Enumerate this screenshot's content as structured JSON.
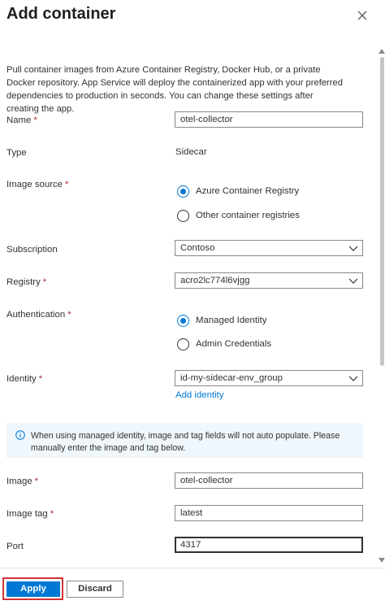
{
  "panel": {
    "title": "Add container",
    "description": "Pull container images from Azure Container Registry, Docker Hub, or a private Docker repository. App Service will deploy the containerized app with your preferred dependencies to production in seconds. You can change these settings after creating the app."
  },
  "form": {
    "name": {
      "label": "Name",
      "required": "*",
      "value": "otel-collector"
    },
    "type": {
      "label": "Type",
      "value": "Sidecar"
    },
    "image_source": {
      "label": "Image source",
      "required": "*",
      "options": [
        {
          "label": "Azure Container Registry",
          "checked": true
        },
        {
          "label": "Other container registries",
          "checked": false
        }
      ]
    },
    "subscription": {
      "label": "Subscription",
      "value": "Contoso"
    },
    "registry": {
      "label": "Registry",
      "required": "*",
      "value": "acro2lc774l6vjgg"
    },
    "authentication": {
      "label": "Authentication",
      "required": "*",
      "options": [
        {
          "label": "Managed Identity",
          "checked": true
        },
        {
          "label": "Admin Credentials",
          "checked": false
        }
      ]
    },
    "identity": {
      "label": "Identity",
      "required": "*",
      "value": "id-my-sidecar-env_group",
      "link": "Add identity"
    },
    "info": {
      "text": "When using managed identity, image and tag fields will not auto populate. Please manually enter the image and tag below."
    },
    "image": {
      "label": "Image",
      "required": "*",
      "value": "otel-collector"
    },
    "image_tag": {
      "label": "Image tag",
      "required": "*",
      "value": "latest"
    },
    "port": {
      "label": "Port",
      "value": "4317"
    }
  },
  "footer": {
    "apply_label": "Apply",
    "discard_label": "Discard"
  },
  "colors": {
    "accent": "#0078d4",
    "required": "#a4262c",
    "highlight": "#d13438",
    "info_bg": "#eff6fc"
  },
  "icons": {
    "close": "close-icon",
    "chevron": "chevron-down-icon",
    "info": "info-icon"
  }
}
